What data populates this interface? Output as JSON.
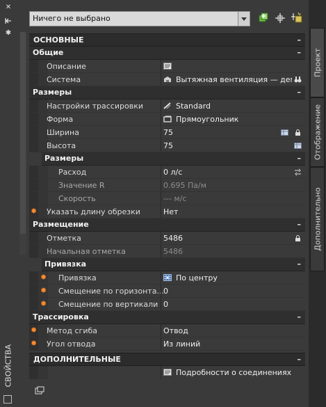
{
  "palette": {
    "section_bg": "#2c2c2c",
    "star": "#ff8a2a",
    "panel_bg": "#3a3a3a"
  },
  "left_strip": {
    "title": "СВОЙСТВА",
    "icons": [
      "close-icon",
      "autohide-icon",
      "settings-icon",
      "properties-icon"
    ]
  },
  "toolbar": {
    "selection_value": "Ничего не выбрано",
    "icons": [
      "quick-select-icon",
      "select-objects-icon",
      "toggle-pickadd-icon"
    ]
  },
  "right_tabs": [
    {
      "label": "Проект"
    },
    {
      "label": "Отображение"
    },
    {
      "label": "Дополнительно"
    }
  ],
  "sections": {
    "osnovnye": "ОСНОВНЫЕ",
    "obshchie": "Общие",
    "razmery": "Размеры",
    "razmery_sub": "Размеры",
    "razmeshchenie": "Размещение",
    "privyazka_sub": "Привязка",
    "trassirovka": "Трассировка",
    "dopolnitelnye": "ДОПОЛНИТЕЛЬНЫЕ"
  },
  "properties": {
    "opisanie": {
      "name": "Описание",
      "value": ""
    },
    "sistema": {
      "name": "Система",
      "value": "Вытяжная  вентиляция — дем"
    },
    "nastroyki": {
      "name": "Настройки трассировки",
      "value": "Standard"
    },
    "forma": {
      "name": "Форма",
      "value": "Прямоугольник"
    },
    "shirina": {
      "name": "Ширина",
      "value": "75"
    },
    "vysota": {
      "name": "Высота",
      "value": "75"
    },
    "raskhod": {
      "name": "Расход",
      "value": "0 л/с"
    },
    "znachenie_r": {
      "name": "Значение R",
      "value": "0.695 Па/м"
    },
    "skorost": {
      "name": "Скорость",
      "value": "--- м/с"
    },
    "dlina_obrezki": {
      "name": "Указать длину обрезки",
      "value": "Нет"
    },
    "otmetka": {
      "name": "Отметка",
      "value": "5486"
    },
    "nach_otmetka": {
      "name": "Начальная отметка",
      "value": "5486"
    },
    "privyazka": {
      "name": "Привязка",
      "value": "По центру"
    },
    "smesch_gor": {
      "name": "Смещение  по  горизонта...",
      "value": "0"
    },
    "smesch_vert": {
      "name": "Смещение по вертикали",
      "value": "0"
    },
    "metod_sgiba": {
      "name": "Метод сгиба",
      "value": "Отвод"
    },
    "ugol_otvoda": {
      "name": "Угол отвода",
      "value": "Из линий"
    },
    "podrobnosti": {
      "name": "",
      "value": "Подробности о соединениях"
    }
  }
}
